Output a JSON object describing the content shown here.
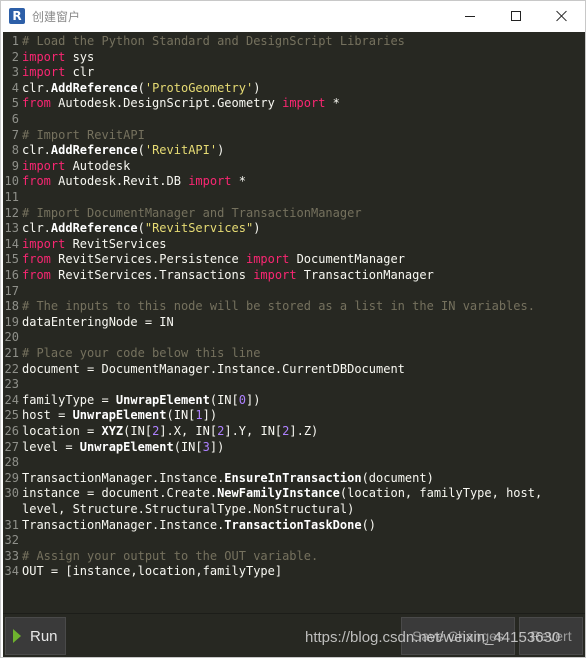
{
  "window": {
    "title": "创建窗户",
    "app_icon_letter": "R",
    "icons": {
      "app": "revit-r-icon",
      "minimize": "minimize-icon",
      "maximize": "maximize-icon",
      "close": "close-icon"
    }
  },
  "editor": {
    "theme_colors": {
      "background": "#272822",
      "keyword": "#f92672",
      "comment": "#75715e",
      "string": "#e6db74",
      "number": "#ae81ff",
      "text": "#f8f8f2"
    },
    "lines": [
      {
        "n": "1",
        "tokens": [
          {
            "t": "comment",
            "v": "# Load the Python Standard and DesignScript Libraries"
          }
        ]
      },
      {
        "n": "2",
        "tokens": [
          {
            "t": "keyword",
            "v": "import"
          },
          {
            "t": "text",
            "v": " sys"
          }
        ]
      },
      {
        "n": "3",
        "tokens": [
          {
            "t": "keyword",
            "v": "import"
          },
          {
            "t": "text",
            "v": " clr"
          }
        ]
      },
      {
        "n": "4",
        "tokens": [
          {
            "t": "text",
            "v": "clr."
          },
          {
            "t": "func",
            "v": "AddReference"
          },
          {
            "t": "text",
            "v": "("
          },
          {
            "t": "string",
            "v": "'ProtoGeometry'"
          },
          {
            "t": "text",
            "v": ")"
          }
        ]
      },
      {
        "n": "5",
        "tokens": [
          {
            "t": "keyword",
            "v": "from"
          },
          {
            "t": "text",
            "v": " Autodesk.DesignScript.Geometry "
          },
          {
            "t": "keyword",
            "v": "import"
          },
          {
            "t": "text",
            "v": " *"
          }
        ]
      },
      {
        "n": "6",
        "tokens": []
      },
      {
        "n": "7",
        "tokens": [
          {
            "t": "comment",
            "v": "# Import RevitAPI"
          }
        ]
      },
      {
        "n": "8",
        "tokens": [
          {
            "t": "text",
            "v": "clr."
          },
          {
            "t": "func",
            "v": "AddReference"
          },
          {
            "t": "text",
            "v": "("
          },
          {
            "t": "string",
            "v": "'RevitAPI'"
          },
          {
            "t": "text",
            "v": ")"
          }
        ]
      },
      {
        "n": "9",
        "tokens": [
          {
            "t": "keyword",
            "v": "import"
          },
          {
            "t": "text",
            "v": " Autodesk"
          }
        ]
      },
      {
        "n": "10",
        "tokens": [
          {
            "t": "keyword",
            "v": "from"
          },
          {
            "t": "text",
            "v": " Autodesk.Revit.DB "
          },
          {
            "t": "keyword",
            "v": "import"
          },
          {
            "t": "text",
            "v": " *"
          }
        ]
      },
      {
        "n": "11",
        "tokens": []
      },
      {
        "n": "12",
        "tokens": [
          {
            "t": "comment",
            "v": "# Import DocumentManager and TransactionManager"
          }
        ]
      },
      {
        "n": "13",
        "tokens": [
          {
            "t": "text",
            "v": "clr."
          },
          {
            "t": "func",
            "v": "AddReference"
          },
          {
            "t": "text",
            "v": "("
          },
          {
            "t": "string",
            "v": "\"RevitServices\""
          },
          {
            "t": "text",
            "v": ")"
          }
        ]
      },
      {
        "n": "14",
        "tokens": [
          {
            "t": "keyword",
            "v": "import"
          },
          {
            "t": "text",
            "v": " RevitServices"
          }
        ]
      },
      {
        "n": "15",
        "tokens": [
          {
            "t": "keyword",
            "v": "from"
          },
          {
            "t": "text",
            "v": " RevitServices.Persistence "
          },
          {
            "t": "keyword",
            "v": "import"
          },
          {
            "t": "text",
            "v": " DocumentManager"
          }
        ]
      },
      {
        "n": "16",
        "tokens": [
          {
            "t": "keyword",
            "v": "from"
          },
          {
            "t": "text",
            "v": " RevitServices.Transactions "
          },
          {
            "t": "keyword",
            "v": "import"
          },
          {
            "t": "text",
            "v": " TransactionManager"
          }
        ]
      },
      {
        "n": "17",
        "tokens": []
      },
      {
        "n": "18",
        "tokens": [
          {
            "t": "comment",
            "v": "# The inputs to this node will be stored as a list in the IN variables."
          }
        ]
      },
      {
        "n": "19",
        "tokens": [
          {
            "t": "text",
            "v": "dataEnteringNode = IN"
          }
        ]
      },
      {
        "n": "20",
        "tokens": []
      },
      {
        "n": "21",
        "tokens": [
          {
            "t": "comment",
            "v": "# Place your code below this line"
          }
        ]
      },
      {
        "n": "22",
        "tokens": [
          {
            "t": "text",
            "v": "document = DocumentManager.Instance.CurrentDBDocument"
          }
        ]
      },
      {
        "n": "23",
        "tokens": []
      },
      {
        "n": "24",
        "tokens": [
          {
            "t": "text",
            "v": "familyType = "
          },
          {
            "t": "func",
            "v": "UnwrapElement"
          },
          {
            "t": "text",
            "v": "(IN["
          },
          {
            "t": "number",
            "v": "0"
          },
          {
            "t": "text",
            "v": "])"
          }
        ]
      },
      {
        "n": "25",
        "tokens": [
          {
            "t": "text",
            "v": "host = "
          },
          {
            "t": "func",
            "v": "UnwrapElement"
          },
          {
            "t": "text",
            "v": "(IN["
          },
          {
            "t": "number",
            "v": "1"
          },
          {
            "t": "text",
            "v": "])"
          }
        ]
      },
      {
        "n": "26",
        "tokens": [
          {
            "t": "text",
            "v": "location = "
          },
          {
            "t": "func",
            "v": "XYZ"
          },
          {
            "t": "text",
            "v": "(IN["
          },
          {
            "t": "number",
            "v": "2"
          },
          {
            "t": "text",
            "v": "].X, IN["
          },
          {
            "t": "number",
            "v": "2"
          },
          {
            "t": "text",
            "v": "].Y, IN["
          },
          {
            "t": "number",
            "v": "2"
          },
          {
            "t": "text",
            "v": "].Z)"
          }
        ]
      },
      {
        "n": "27",
        "tokens": [
          {
            "t": "text",
            "v": "level = "
          },
          {
            "t": "func",
            "v": "UnwrapElement"
          },
          {
            "t": "text",
            "v": "(IN["
          },
          {
            "t": "number",
            "v": "3"
          },
          {
            "t": "text",
            "v": "])"
          }
        ]
      },
      {
        "n": "28",
        "tokens": []
      },
      {
        "n": "29",
        "tokens": [
          {
            "t": "text",
            "v": "TransactionManager.Instance."
          },
          {
            "t": "func",
            "v": "EnsureInTransaction"
          },
          {
            "t": "text",
            "v": "(document)"
          }
        ]
      },
      {
        "n": "30",
        "tokens": [
          {
            "t": "text",
            "v": "instance = document.Create."
          },
          {
            "t": "func",
            "v": "NewFamilyInstance"
          },
          {
            "t": "text",
            "v": "(location, familyType, host,"
          }
        ]
      },
      {
        "n": "",
        "tokens": [
          {
            "t": "text",
            "v": "level, Structure.StructuralType.NonStructural)"
          }
        ]
      },
      {
        "n": "31",
        "tokens": [
          {
            "t": "text",
            "v": "TransactionManager.Instance."
          },
          {
            "t": "func",
            "v": "TransactionTaskDone"
          },
          {
            "t": "text",
            "v": "()"
          }
        ]
      },
      {
        "n": "32",
        "tokens": []
      },
      {
        "n": "33",
        "tokens": [
          {
            "t": "comment",
            "v": "# Assign your output to the OUT variable."
          }
        ]
      },
      {
        "n": "34",
        "tokens": [
          {
            "t": "text",
            "v": "OUT = [instance,location,familyType]"
          }
        ]
      }
    ]
  },
  "footer": {
    "run_label": "Run",
    "run_icon": "play-icon",
    "save_label": "Save Changes",
    "revert_label": "Revert",
    "watermark": "https://blog.csdn.net/weixin_44153630"
  }
}
